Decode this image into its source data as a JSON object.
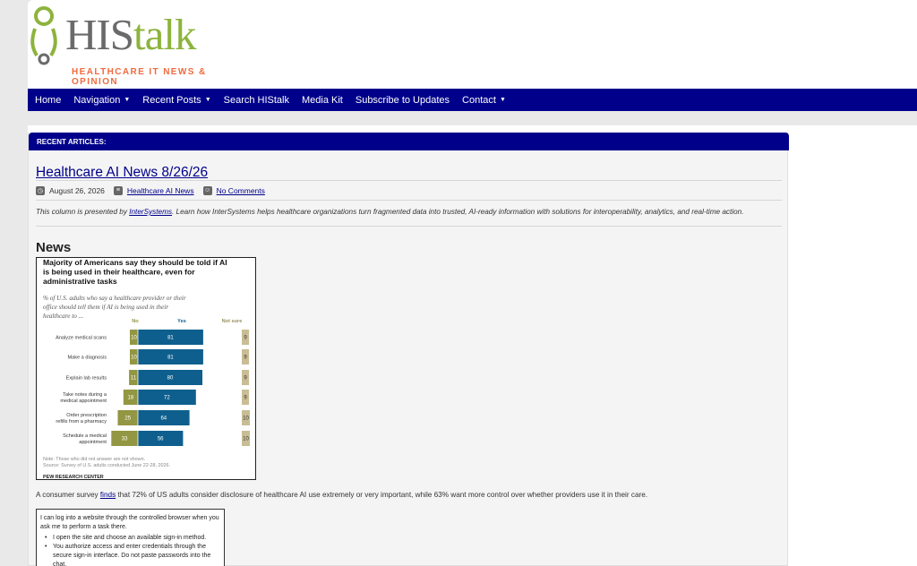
{
  "site": {
    "logo_main": "HIS",
    "logo_accent": "talk",
    "tagline": "HEALTHCARE IT NEWS & OPINION"
  },
  "nav": [
    {
      "label": "Home",
      "caret": false
    },
    {
      "label": "Navigation",
      "caret": true
    },
    {
      "label": "Recent Posts",
      "caret": true
    },
    {
      "label": "Search HIStalk",
      "caret": false
    },
    {
      "label": "Media Kit",
      "caret": false
    },
    {
      "label": "Subscribe to Updates",
      "caret": false
    },
    {
      "label": "Contact",
      "caret": true
    }
  ],
  "panel": {
    "heading": "RECENT ARTICLES:"
  },
  "post": {
    "title": "Healthcare AI News 8/26/26",
    "date": "August 26, 2026",
    "category": "Healthcare AI News",
    "comments": "No Comments",
    "intro_prefix": "This column is presented by ",
    "intro_link": "InterSystems",
    "intro_suffix": ". Learn how InterSystems helps healthcare organizations turn fragmented data into trusted, AI-ready information with solutions for interoperability, analytics, and real-time action.",
    "section": "News",
    "survey_prefix": "A consumer survey ",
    "survey_link": "finds",
    "survey_suffix": " that 72% of US adults consider disclosure of healthcare AI use extremely or very important, while 63% want more control over whether providers use it in their care."
  },
  "chart_data": {
    "type": "bar",
    "title": "Majority of Americans say they should be told if AI is being used in their healthcare, even for administrative tasks",
    "subtitle": "% of U.S. adults who say a healthcare provider or their office should tell them if AI is being used in their healthcare to ...",
    "columns": [
      "No",
      "Yes",
      "Not sure"
    ],
    "categories": [
      "Analyze medical scans",
      "Make a diagnosis",
      "Explain lab results",
      "Take notes during a medical appointment",
      "Order prescription refills from a pharmacy",
      "Schedule a medical appointment"
    ],
    "series": [
      {
        "name": "No",
        "values": [
          10,
          10,
          11,
          18,
          25,
          33
        ],
        "color": "#939642"
      },
      {
        "name": "Yes",
        "values": [
          81,
          81,
          80,
          72,
          64,
          56
        ],
        "color": "#0e5f8d"
      },
      {
        "name": "Not sure",
        "values": [
          9,
          9,
          9,
          9,
          10,
          10
        ],
        "color": "#c9bd95"
      }
    ],
    "note": "Note: Those who did not answer are not shown.",
    "source": "Source: Survey of U.S. adults conducted June 22-28, 2026.",
    "credit": "PEW RESEARCH CENTER"
  },
  "task_card": {
    "intro": "I can log into a website through the controlled browser when you ask me to perform a task there.",
    "items": [
      "I open the site and choose an available sign-in method.",
      "You authorize access and enter credentials through the secure sign-in interface. Do not paste passwords into the chat."
    ]
  },
  "colors": {
    "nav": "#00008b",
    "logo_green": "#8db33d",
    "tagline": "#f06a3e"
  }
}
